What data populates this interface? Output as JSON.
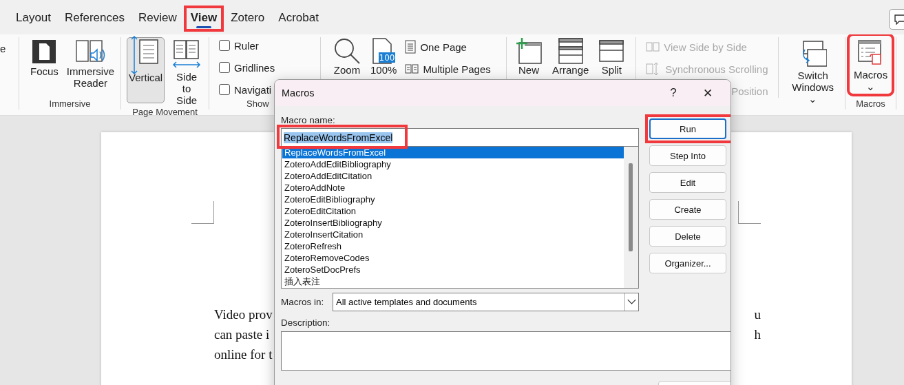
{
  "tabs": [
    {
      "label": "Layout",
      "selected": false,
      "highlighted": false
    },
    {
      "label": "References",
      "selected": false,
      "highlighted": false
    },
    {
      "label": "Review",
      "selected": false,
      "highlighted": false
    },
    {
      "label": "View",
      "selected": true,
      "highlighted": true
    },
    {
      "label": "Zotero",
      "selected": false,
      "highlighted": false
    },
    {
      "label": "Acrobat",
      "selected": false,
      "highlighted": false
    }
  ],
  "ribbon": {
    "cut_label": "e",
    "immersive": {
      "label": "Immersive",
      "buttons": [
        {
          "kind": "focus",
          "label": "Focus"
        },
        {
          "kind": "reader",
          "label": "Immersive Reader"
        }
      ]
    },
    "page_movement": {
      "label": "Page Movement",
      "buttons": [
        {
          "kind": "vertical",
          "label": "Vertical",
          "selected": true
        },
        {
          "kind": "side",
          "label": "Side to Side",
          "selected": false
        }
      ]
    },
    "show": {
      "label": "Show",
      "checkboxes": [
        {
          "label": "Ruler",
          "checked": false
        },
        {
          "label": "Gridlines",
          "checked": false
        },
        {
          "label": "Navigati",
          "checked": false
        }
      ]
    },
    "zoom": {
      "buttons": [
        {
          "kind": "zoom",
          "label": "Zoom"
        },
        {
          "kind": "hundred",
          "label": "100%",
          "badge": "100"
        }
      ],
      "small": [
        {
          "kind": "one",
          "label": "One Page"
        },
        {
          "kind": "multi",
          "label": "Multiple Pages"
        }
      ]
    },
    "window": {
      "buttons": [
        {
          "kind": "new",
          "label": "New"
        },
        {
          "kind": "arrange",
          "label": "Arrange"
        },
        {
          "kind": "split",
          "label": "Split"
        }
      ],
      "small": [
        {
          "kind": "side",
          "label": "View Side by Side",
          "disabled": true
        },
        {
          "kind": "sync",
          "label": "Synchronous Scrolling",
          "disabled": true
        },
        {
          "kind": "reset",
          "label": "Position",
          "disabled": true
        }
      ],
      "switch": {
        "label": "Switch Windows",
        "caret": "⌄"
      }
    },
    "macros": {
      "label": "Macros",
      "button": "Macros",
      "caret": "⌄",
      "highlighted": true
    }
  },
  "document": {
    "lines": [
      {
        "left": "Video prov",
        "right": "u"
      },
      {
        "left": "can paste i",
        "right": "h"
      },
      {
        "left": "online for t"
      }
    ]
  },
  "dialog": {
    "title": "Macros",
    "help": "?",
    "close": "✕",
    "name_label": "Macro name:",
    "name_value": "ReplaceWordsFromExcel",
    "name_highlighted": true,
    "macros": [
      {
        "name": "ReplaceWordsFromExcel",
        "selected": true
      },
      {
        "name": "ZoteroAddEditBibliography",
        "selected": false
      },
      {
        "name": "ZoteroAddEditCitation",
        "selected": false
      },
      {
        "name": "ZoteroAddNote",
        "selected": false
      },
      {
        "name": "ZoteroEditBibliography",
        "selected": false
      },
      {
        "name": "ZoteroEditCitation",
        "selected": false
      },
      {
        "name": "ZoteroInsertBibliography",
        "selected": false
      },
      {
        "name": "ZoteroInsertCitation",
        "selected": false
      },
      {
        "name": "ZoteroRefresh",
        "selected": false
      },
      {
        "name": "ZoteroRemoveCodes",
        "selected": false
      },
      {
        "name": "ZoteroSetDocPrefs",
        "selected": false
      },
      {
        "name": "插入表注",
        "selected": false
      }
    ],
    "buttons": [
      {
        "label": "Run",
        "default": true,
        "highlighted": true
      },
      {
        "label": "Step Into",
        "default": false,
        "highlighted": false
      },
      {
        "label": "Edit",
        "default": false,
        "highlighted": false
      },
      {
        "label": "Create",
        "default": false,
        "highlighted": false
      },
      {
        "label": "Delete",
        "default": false,
        "highlighted": false
      },
      {
        "label": "Organizer...",
        "default": false,
        "highlighted": false
      }
    ],
    "macros_in_label": "Macros in:",
    "macros_in_value": "All active templates and documents",
    "description_label": "Description:"
  }
}
